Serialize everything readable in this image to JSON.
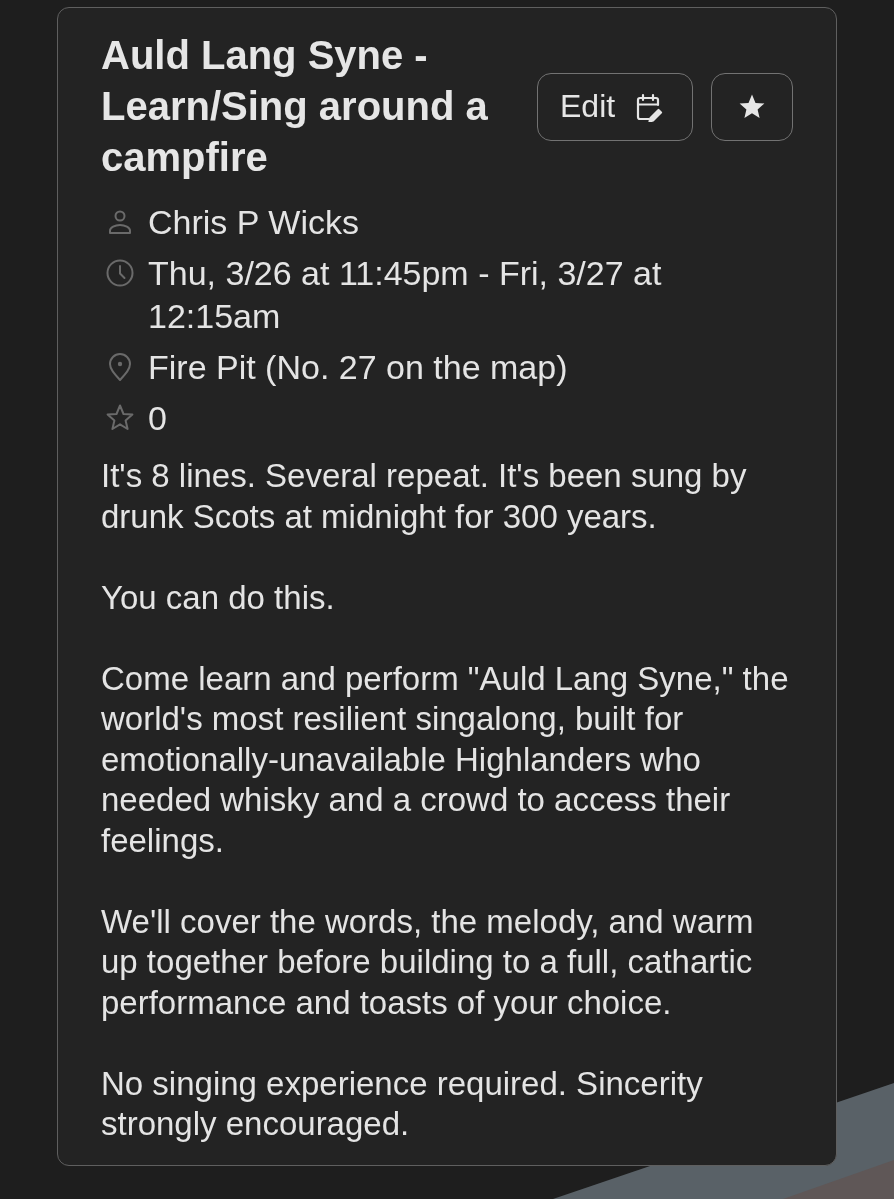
{
  "event": {
    "title": "Auld Lang Syne - Learn/Sing around a campfire",
    "edit_button": {
      "label": "Edit"
    },
    "meta": [
      {
        "kind": "host",
        "text": "Chris P Wicks"
      },
      {
        "kind": "time",
        "text": "Thu, 3/26 at 11:45pm - Fri, 3/27 at 12:15am"
      },
      {
        "kind": "location",
        "text": "Fire Pit (No. 27 on the map)"
      },
      {
        "kind": "favorites",
        "text": "0"
      }
    ],
    "description": [
      "It's 8 lines. Several repeat. It's been sung by drunk Scots at midnight for 300 years.",
      "You can do this.",
      "Come learn and perform \"Auld Lang Syne,\" the world's most resilient singalong, built for emotionally-unavailable Highlanders who needed whisky and a crowd to access their feelings.",
      "We'll cover the words, the melody, and warm up together before building to a full, cathartic performance and toasts of your choice.",
      "No singing experience required. Sincerity strongly encouraged."
    ]
  }
}
